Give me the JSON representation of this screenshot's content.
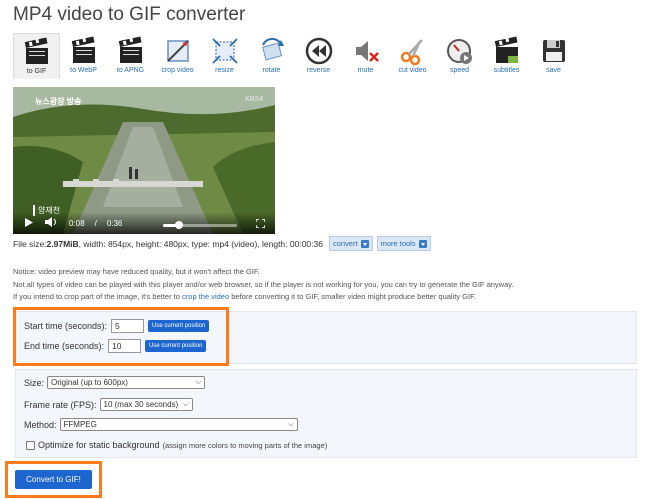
{
  "page": {
    "title": "MP4 video to GIF converter"
  },
  "toolbar": {
    "items": [
      {
        "label": "to GIF",
        "icon": "clapperboard-icon",
        "active": true
      },
      {
        "label": "to WebP",
        "icon": "clapperboard-icon"
      },
      {
        "label": "to APNG",
        "icon": "clapperboard-icon"
      },
      {
        "label": "crop video",
        "icon": "crop-icon"
      },
      {
        "label": "resize",
        "icon": "resize-icon"
      },
      {
        "label": "rotate",
        "icon": "rotate-icon"
      },
      {
        "label": "reverse",
        "icon": "rewind-icon"
      },
      {
        "label": "mute",
        "icon": "mute-icon"
      },
      {
        "label": "cut video",
        "icon": "scissors-icon"
      },
      {
        "label": "speed",
        "icon": "speedometer-icon"
      },
      {
        "label": "subtitles",
        "icon": "clapperboard-icon"
      },
      {
        "label": "save",
        "icon": "floppy-disk-icon"
      }
    ]
  },
  "video": {
    "logo": "뉴스광장 방송",
    "logo_right": "KBS4",
    "caption": "양재천",
    "current_time": "0:08",
    "separator": "/",
    "duration": "0:36",
    "progress": 0.22
  },
  "fileinfo": {
    "prefix": "File size: ",
    "size": "2.97MiB",
    "rest": ", width: 854px, height: 480px, type: mp4 (video), length: 00:00:36",
    "convert_label": "convert",
    "more_tools_label": "more tools"
  },
  "notice": {
    "line1": "Notice: video preview may have reduced quality, but it won't affect the GIF.",
    "line2": "Not all types of video can be played with this player and/or web browser, so if the player is not working for you, you can try to generate the GIF anyway.",
    "line3_a": "If you intend to crop part of the image, it's better to ",
    "line3_link": "crop the video",
    "line3_b": " before converting it to GIF, smaller video might produce better quality GIF."
  },
  "time": {
    "start_label": "Start time (seconds):",
    "start_value": "5",
    "end_label": "End time (seconds):",
    "end_value": "10",
    "use_current_label": "Use current position"
  },
  "options": {
    "size_label": "Size:",
    "size_value": "Original (up to 600px)",
    "fps_label": "Frame rate (FPS):",
    "fps_value": "10 (max 30 seconds)",
    "method_label": "Method:",
    "method_value": "FFMPEG",
    "optimize_label": "Optimize for static background",
    "optimize_hint": "(assign more colors to moving parts of the image)"
  },
  "convert": {
    "label": "Convert to GIF!"
  },
  "colors": {
    "accent": "#1e66cf",
    "highlight": "#ff7a1a",
    "link": "#2a6db0"
  }
}
